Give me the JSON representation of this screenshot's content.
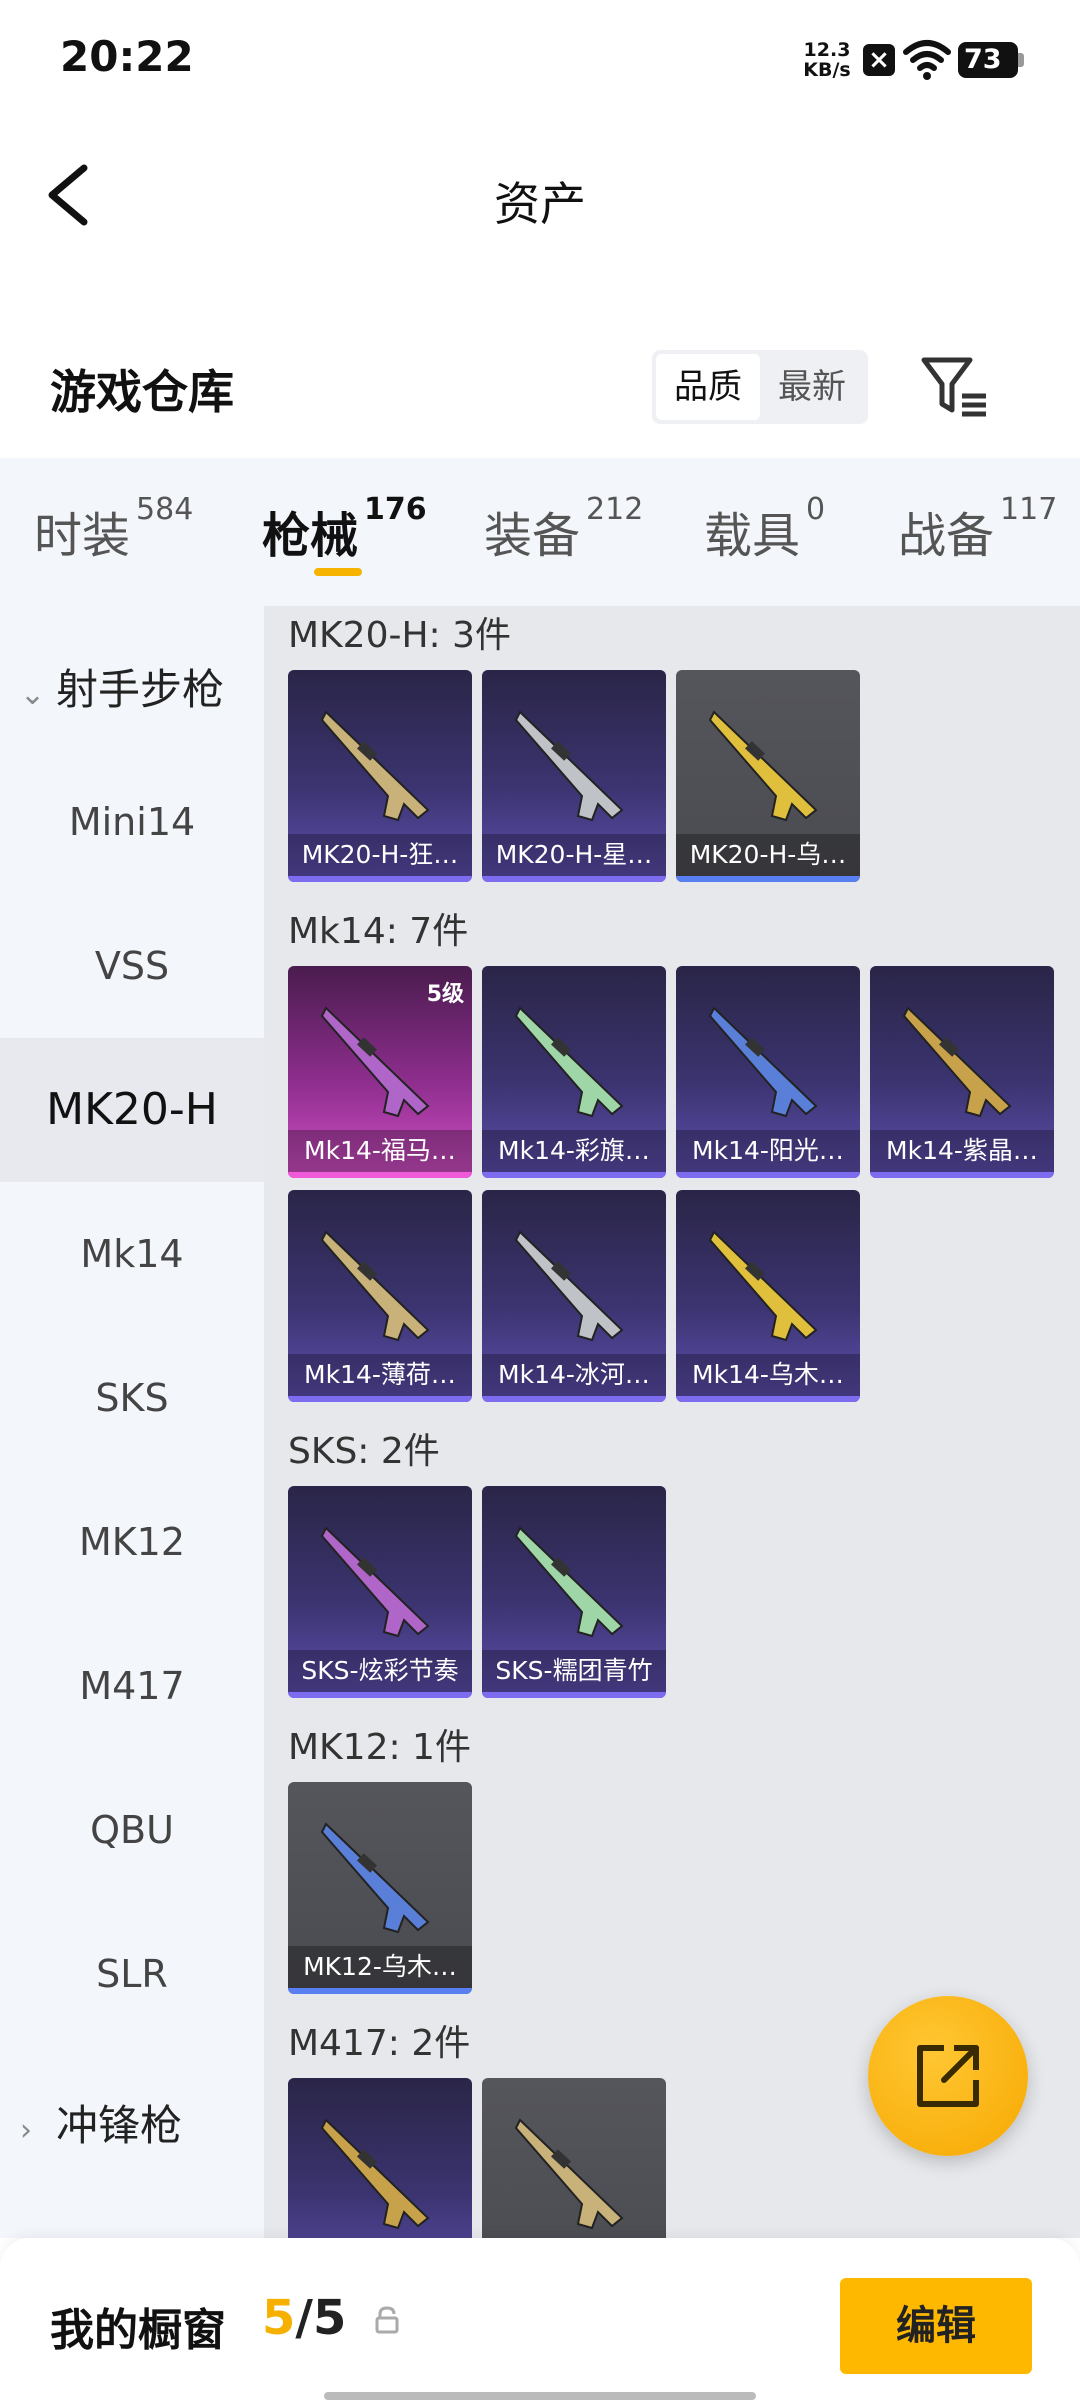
{
  "status_bar": {
    "time": "20:22",
    "net_speed": "12.3",
    "net_unit": "KB/s",
    "battery": "73"
  },
  "header": {
    "title": "资产"
  },
  "warehouse": {
    "title": "游戏仓库",
    "sort_options": [
      "品质",
      "最新"
    ],
    "sort_selected": "品质"
  },
  "tabs": [
    {
      "label": "时装",
      "count": "584"
    },
    {
      "label": "枪械",
      "count": "176"
    },
    {
      "label": "装备",
      "count": "212"
    },
    {
      "label": "载具",
      "count": "0"
    },
    {
      "label": "战备",
      "count": "117"
    }
  ],
  "sidebar": {
    "group_open": "射手步枪",
    "items": [
      "Mini14",
      "VSS",
      "MK20-H",
      "Mk14",
      "SKS",
      "MK12",
      "M417",
      "QBU",
      "SLR"
    ],
    "selected": "MK20-H",
    "group_closed": "冲锋枪"
  },
  "sections": [
    {
      "title": "MK20-H: 3件",
      "items": [
        {
          "name": "MK20-H-狂…",
          "bg": "purple"
        },
        {
          "name": "MK20-H-星…",
          "bg": "purple"
        },
        {
          "name": "MK20-H-乌…",
          "bg": "grey"
        }
      ]
    },
    {
      "title": "Mk14: 7件",
      "items": [
        {
          "name": "Mk14-福马…",
          "bg": "pink",
          "level": "5级"
        },
        {
          "name": "Mk14-彩旗…",
          "bg": "purple"
        },
        {
          "name": "Mk14-阳光…",
          "bg": "purple"
        },
        {
          "name": "Mk14-紫晶…",
          "bg": "purple"
        },
        {
          "name": "Mk14-薄荷…",
          "bg": "purple"
        },
        {
          "name": "Mk14-冰河…",
          "bg": "purple"
        },
        {
          "name": "Mk14-乌木…",
          "bg": "purple"
        }
      ]
    },
    {
      "title": "SKS: 2件",
      "items": [
        {
          "name": "SKS-炫彩节奏",
          "bg": "purple"
        },
        {
          "name": "SKS-糯团青竹",
          "bg": "purple"
        }
      ]
    },
    {
      "title": "MK12: 1件",
      "items": [
        {
          "name": "MK12-乌木…",
          "bg": "grey"
        }
      ]
    },
    {
      "title": "M417: 2件",
      "items": [
        {
          "name": "",
          "bg": "purple"
        },
        {
          "name": "",
          "bg": "grey"
        }
      ]
    }
  ],
  "bottom": {
    "showcase_label": "我的橱窗",
    "current": "5",
    "total": "5",
    "edit_label": "编辑"
  },
  "colors": {
    "accent": "#ffb800",
    "tab_indicator": "#f6b300",
    "card_purple": "#3b3470",
    "card_grey": "#4a4b51",
    "card_pink": "#8e2e8e"
  }
}
